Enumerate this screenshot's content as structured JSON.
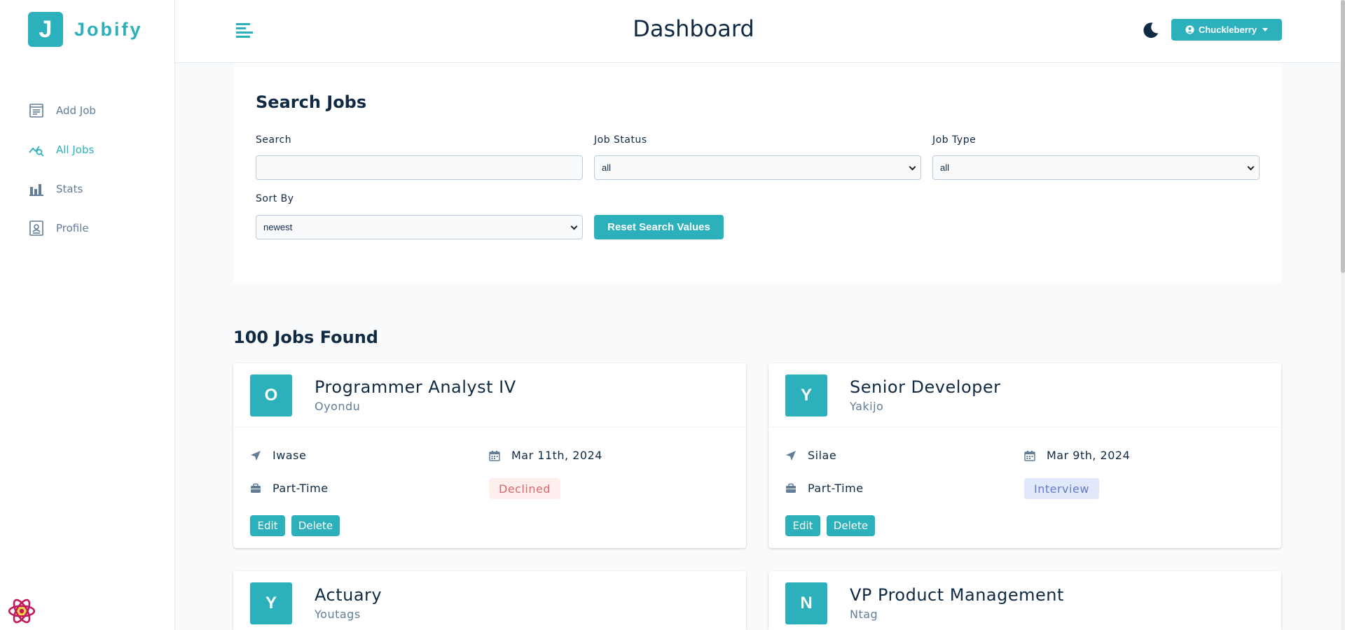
{
  "brand": {
    "logo_letter": "J",
    "name": "Jobify"
  },
  "sidebar": {
    "items": [
      {
        "label": "Add Job",
        "icon": "add-job-icon"
      },
      {
        "label": "All Jobs",
        "icon": "all-jobs-icon"
      },
      {
        "label": "Stats",
        "icon": "stats-icon"
      },
      {
        "label": "Profile",
        "icon": "profile-icon"
      }
    ]
  },
  "header": {
    "title": "Dashboard",
    "user": "Chuckleberry"
  },
  "search": {
    "title": "Search Jobs",
    "search_label": "Search",
    "search_value": "",
    "status_label": "Job Status",
    "status_value": "all",
    "type_label": "Job Type",
    "type_value": "all",
    "sort_label": "Sort By",
    "sort_value": "newest",
    "reset_label": "Reset Search Values"
  },
  "jobs_found": "100 Jobs Found",
  "jobs": [
    {
      "letter": "O",
      "position": "Programmer Analyst IV",
      "company": "Oyondu",
      "location": "Iwase",
      "date": "Mar 11th, 2024",
      "type": "Part-Time",
      "status": "Declined"
    },
    {
      "letter": "Y",
      "position": "Senior Developer",
      "company": "Yakijo",
      "location": "Silae",
      "date": "Mar 9th, 2024",
      "type": "Part-Time",
      "status": "Interview"
    },
    {
      "letter": "Y",
      "position": "Actuary",
      "company": "Youtags"
    },
    {
      "letter": "N",
      "position": "VP Product Management",
      "company": "Ntag"
    }
  ],
  "card_actions": {
    "edit": "Edit",
    "delete": "Delete"
  },
  "colors": {
    "primary": "#2cb1bc",
    "declined_bg": "#ffeeee",
    "declined_text": "#d66a6a",
    "interview_bg": "#e0e8f9",
    "interview_text": "#647acb"
  }
}
